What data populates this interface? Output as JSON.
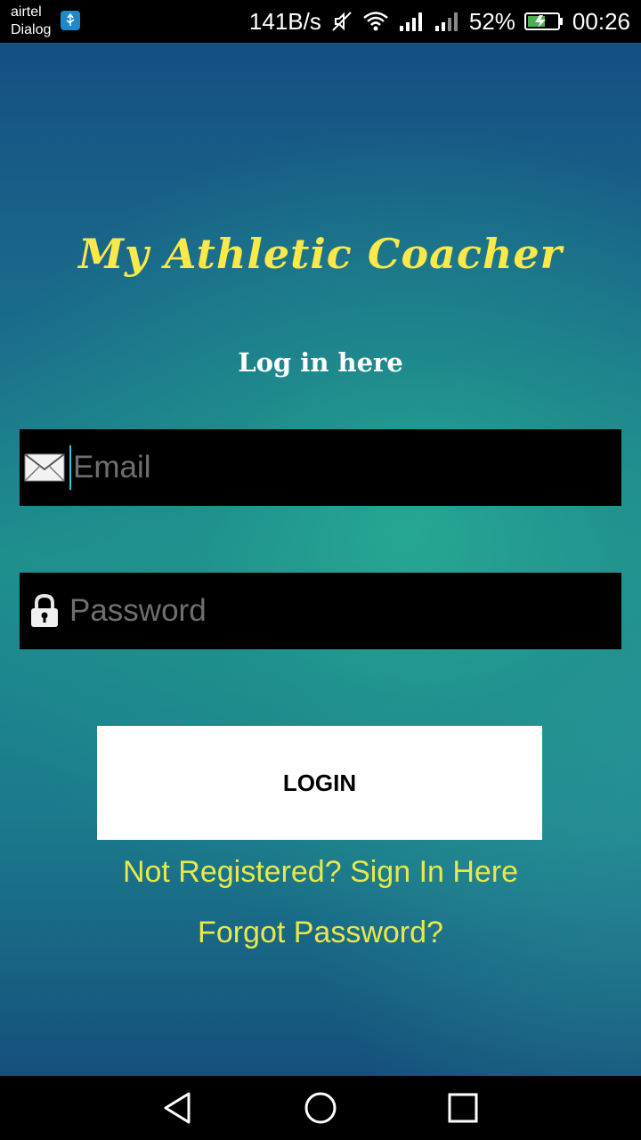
{
  "status_bar": {
    "carrier_line1": "airtel",
    "carrier_line2": "Dialog",
    "network_speed": "141B/s",
    "battery_percent": "52%",
    "time": "00:26"
  },
  "app": {
    "title": "My Athletic Coacher",
    "subtitle": "Log in here"
  },
  "form": {
    "email_placeholder": "Email",
    "email_value": "",
    "password_placeholder": "Password",
    "password_value": "",
    "login_label": "LOGIN"
  },
  "links": {
    "register": "Not Registered? Sign In Here",
    "forgot": "Forgot Password?"
  },
  "colors": {
    "title": "#fbe84a",
    "link": "#e8e84a",
    "field_background": "#000000",
    "button_background": "#ffffff"
  },
  "icons": {
    "email": "envelope-icon",
    "password": "lock-icon"
  }
}
